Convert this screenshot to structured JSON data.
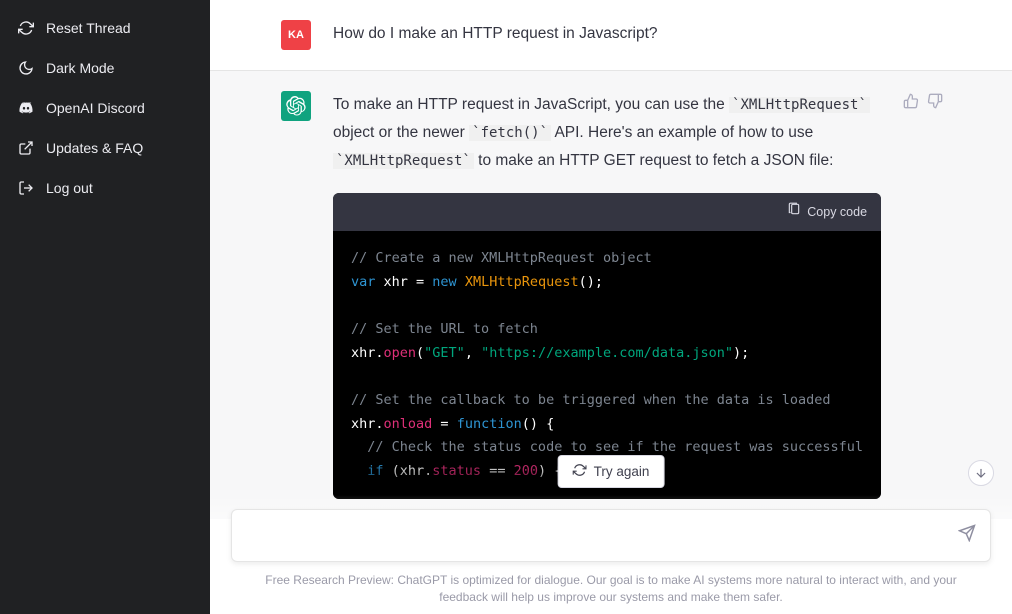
{
  "sidebar": {
    "items": [
      {
        "label": "Reset Thread"
      },
      {
        "label": "Dark Mode"
      },
      {
        "label": "OpenAI Discord"
      },
      {
        "label": "Updates & FAQ"
      },
      {
        "label": "Log out"
      }
    ]
  },
  "user": {
    "avatar": "KA",
    "message": "How do I make an HTTP request in Javascript?"
  },
  "assistant": {
    "text_pre1": "To make an HTTP request in JavaScript, you can use the ",
    "code1": "`XMLHttpRequest`",
    "text_mid1": " object or the newer ",
    "code2": "`fetch()`",
    "text_mid2": " API. Here's an example of how to use ",
    "code3": "`XMLHttpRequest`",
    "text_post": " to make an HTTP GET request to fetch a JSON file:",
    "copy_label": "Copy code",
    "code": {
      "c1": "// Create a new XMLHttpRequest object",
      "l2_var": "var",
      "l2_name": " xhr = ",
      "l2_new": "new",
      "l2_cls": " XMLHttpRequest",
      "l2_tail": "();",
      "c2": "// Set the URL to fetch",
      "l4_head": "xhr.",
      "l4_open": "open",
      "l4_p1": "(",
      "l4_s1": "\"GET\"",
      "l4_c": ", ",
      "l4_s2": "\"https://example.com/data.json\"",
      "l4_p2": ");",
      "c3": "// Set the callback to be triggered when the data is loaded",
      "l6_head": "xhr.",
      "l6_onload": "onload",
      "l6_eq": " = ",
      "l6_fn": "function",
      "l6_tail": "() {",
      "c4": "  // Check the status code to see if the request was successful",
      "l8_if": "  if",
      "l8_cond1": " (xhr.",
      "l8_status": "status",
      "l8_eq": " == ",
      "l8_200": "200",
      "l8_tail": ") {"
    }
  },
  "controls": {
    "try_again": "Try again"
  },
  "input": {
    "placeholder": ""
  },
  "footer": "Free Research Preview: ChatGPT is optimized for dialogue. Our goal is to make AI systems more natural to interact with, and your feedback will help us improve our systems and make them safer."
}
